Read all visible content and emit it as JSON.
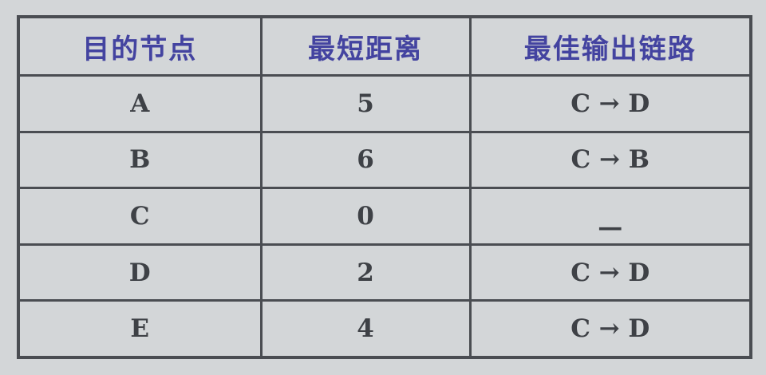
{
  "header": {
    "destination": "目的节点",
    "distance": "最短距离",
    "next_link": "最佳输出链路"
  },
  "rows": [
    {
      "node": "A",
      "distance": "5",
      "link": "C → D"
    },
    {
      "node": "B",
      "distance": "6",
      "link": "C → B"
    },
    {
      "node": "C",
      "distance": "0",
      "link": "—"
    },
    {
      "node": "D",
      "distance": "2",
      "link": "C → D"
    },
    {
      "node": "E",
      "distance": "4",
      "link": "C → D"
    }
  ]
}
